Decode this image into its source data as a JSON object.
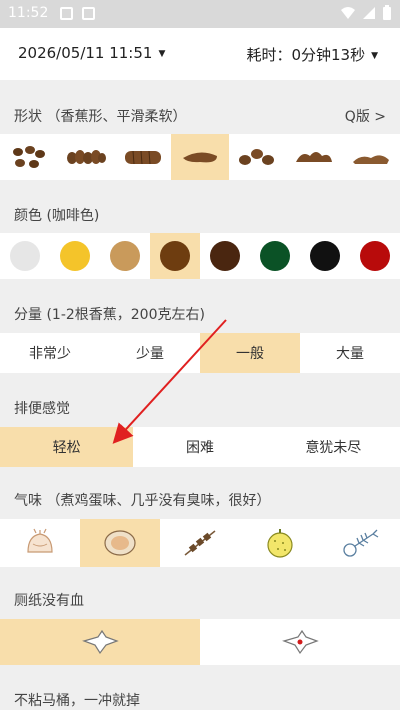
{
  "status_bar": {
    "time": "11:52"
  },
  "header": {
    "date_time": "2026/05/11 11:51",
    "duration": "耗时：0分钟13秒"
  },
  "shape": {
    "label": "形状 （香蕉形、平滑柔软）",
    "q_version": "Q版 >",
    "options": [
      "shape-1",
      "shape-2",
      "shape-3",
      "shape-4",
      "shape-5",
      "shape-6",
      "shape-7"
    ],
    "selected_index": 3
  },
  "color": {
    "label": "颜色 (咖啡色)",
    "options": [
      "#e6e6e6",
      "#f4c42a",
      "#c99a5b",
      "#6e3d10",
      "#4a2610",
      "#0b5226",
      "#111111",
      "#b80b0b"
    ],
    "selected_index": 3
  },
  "amount": {
    "label": "分量 (1-2根香蕉，200克左右)",
    "options": [
      "非常少",
      "少量",
      "一般",
      "大量"
    ],
    "selected_index": 2
  },
  "feeling": {
    "label": "排便感觉",
    "options": [
      "轻松",
      "困难",
      "意犹未尽"
    ],
    "selected_index": 0
  },
  "smell": {
    "label": "气味 （煮鸡蛋味、几乎没有臭味，很好）",
    "options": [
      "bun-icon",
      "egg-icon",
      "skewer-icon",
      "durian-icon",
      "fish-bone-icon"
    ],
    "selected_index": 1
  },
  "blood": {
    "label": "厕纸没有血",
    "options": [
      "tissue-clean-icon",
      "tissue-blood-icon"
    ],
    "selected_index": 0
  },
  "stick": {
    "label": "不粘马桶，一冲就掉"
  },
  "colors": {
    "selected_bg": "#f8deab",
    "arrow": "#e02020"
  }
}
